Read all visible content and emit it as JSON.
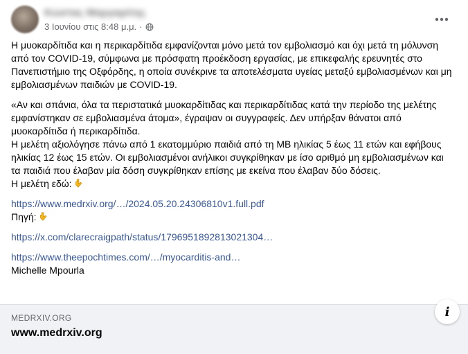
{
  "post": {
    "author_name": "Κώστας Μαργαρίτης",
    "timestamp": "3 Ιουνίου στις 8:48 μ.μ.",
    "separator": "·",
    "privacy_icon": "globe-icon",
    "more_icon": "more-horizontal-icon",
    "paragraph_1": "Η μυοκαρδίτιδα και η περικαρδίτιδα εμφανίζονται μόνο μετά τον εμβολιασμό και όχι μετά τη μόλυνση από τον COVID-19, σύμφωνα με πρόσφατη προέκδοση εργασίας, με επικεφαλής ερευνητές στο Πανεπιστήμιο της Οξφόρδης, η οποία συνέκρινε τα αποτελέσματα υγείας μεταξύ εμβολιασμένων και μη εμβολιασμένων παιδιών με COVID-19.",
    "paragraph_2a": "«Αν και σπάνια, όλα τα περιστατικά μυοκαρδίτιδας και περικαρδίτιδας κατά την περίοδο της μελέτης εμφανίστηκαν σε εμβολιασμένα άτομα», έγραψαν οι συγγραφείς. Δεν υπήρξαν θάνατοι από μυοκαρδίτιδα ή περικαρδίτιδα.",
    "paragraph_2b": "Η μελέτη αξιολόγησε πάνω από 1 εκατομμύριο παιδιά από τη ΜΒ ηλικίας 5 έως 11 ετών και εφήβους ηλικίας 12 έως 15 ετών. Οι εμβολιασμένοι ανήλικοι συγκρίθηκαν με ίσο αριθμό μη εμβολιασμένων και τα παιδιά που έλαβαν μία δόση συγκρίθηκαν επίσης με εκείνα που έλαβαν δύο δόσεις.",
    "study_label": "Η μελέτη εδώ:",
    "link_1": "https://www.medrxiv.org/…/2024.05.20.24306810v1.full.pdf",
    "source_label": "Πηγή:",
    "link_2": "https://x.com/clarecraigpath/status/1796951892813021304…",
    "link_3": "https://www.theepochtimes.com/…/myocarditis-and…",
    "signature": "Michelle Mpourla",
    "pointing_emoji_icon": "backhand-index-pointing-down-icon"
  },
  "link_preview": {
    "domain": "MEDRXIV.ORG",
    "title": "www.medrxiv.org",
    "info_label": "i",
    "info_icon": "info-icon"
  }
}
